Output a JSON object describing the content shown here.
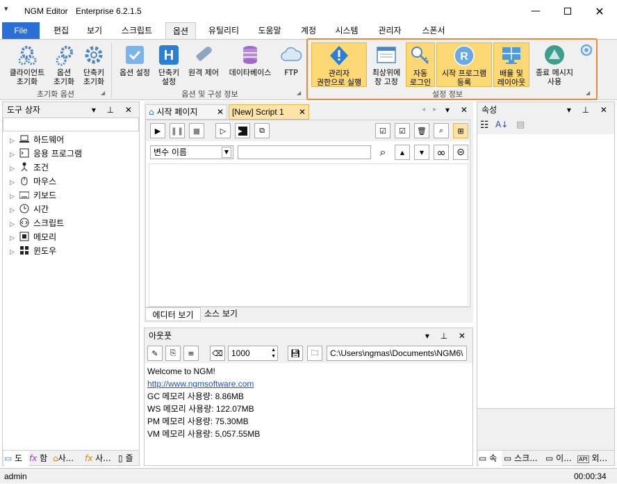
{
  "app": {
    "title": "NGM Editor",
    "edition": "Enterprise 6.2.1.5",
    "qat_icon": "dropdown-icon"
  },
  "window_controls": [
    "minimize-icon",
    "maximize-icon",
    "close-icon"
  ],
  "tabs": [
    {
      "label": "File"
    },
    {
      "label": "편집"
    },
    {
      "label": "보기"
    },
    {
      "label": "스크립트"
    },
    {
      "label": "옵션"
    },
    {
      "label": "유틸리티"
    },
    {
      "label": "도움말"
    },
    {
      "label": "계정"
    },
    {
      "label": "시스템"
    },
    {
      "label": "관리자"
    },
    {
      "label": "스폰서"
    }
  ],
  "ribbon": {
    "reset_group": {
      "name": "초기화 옵션",
      "buttons": [
        {
          "line1": "클라이언트",
          "line2": "초기화",
          "icon": "gear-cluster-icon"
        },
        {
          "line1": "옵션",
          "line2": "초기화",
          "icon": "gear-cluster-icon"
        },
        {
          "line1": "단축키",
          "line2": "초기화",
          "icon": "gear-icon"
        }
      ]
    },
    "options_group": {
      "name": "옵션 및 구성 정보",
      "buttons": [
        {
          "line1": "옵션 설정",
          "line2": "",
          "icon": "checkbox-icon"
        },
        {
          "line1": "단축키",
          "line2": "설정",
          "icon": "hotkey-h-icon"
        },
        {
          "line1": "원격 제어",
          "line2": "",
          "icon": "remote-control-icon"
        },
        {
          "line1": "데이타베이스",
          "line2": "",
          "icon": "database-icon"
        },
        {
          "line1": "FTP",
          "line2": "",
          "icon": "cloud-icon"
        }
      ]
    },
    "settings_group": {
      "name": "설정 정보",
      "buttons": [
        {
          "line1": "관리자",
          "line2": "권한으로 실행",
          "icon": "admin-shield-icon",
          "active": true
        },
        {
          "line1": "최상위에",
          "line2": "창 고정",
          "icon": "window-icon",
          "active": false
        },
        {
          "line1": "자동",
          "line2": "로그인",
          "icon": "key-icon",
          "active": true
        },
        {
          "line1": "시작 프로그램",
          "line2": "등록",
          "icon": "registry-r-icon",
          "active": true
        },
        {
          "line1": "배율 및",
          "line2": "레이아웃",
          "icon": "monitor-icon",
          "active": true
        },
        {
          "line1": "종료 메시지",
          "line2": "사용",
          "icon": "warning-message-icon",
          "active": false
        }
      ]
    }
  },
  "toolbox": {
    "title": "도구 상자",
    "items": [
      {
        "label": "하드웨어",
        "icon": "laptop-icon"
      },
      {
        "label": "응용 프로그램",
        "icon": "terminal-icon"
      },
      {
        "label": "조건",
        "icon": "condition-icon"
      },
      {
        "label": "마우스",
        "icon": "mouse-icon"
      },
      {
        "label": "키보드",
        "icon": "keyboard-icon"
      },
      {
        "label": "시간",
        "icon": "clock-icon"
      },
      {
        "label": "스크립트",
        "icon": "script-icon"
      },
      {
        "label": "메모리",
        "icon": "memory-icon"
      },
      {
        "label": "윈도우",
        "icon": "windows-icon"
      }
    ],
    "bottom_tabs": [
      "도",
      "함",
      "사...",
      "사...",
      "즐"
    ]
  },
  "editor": {
    "tabs": [
      {
        "label": "시작 페이지",
        "active": false
      },
      {
        "label": "[New] Script 1",
        "active": true
      }
    ],
    "variable_select": "변수 이름",
    "bottom_tabs": [
      "에디터 보기",
      "소스 보기"
    ]
  },
  "output": {
    "title": "아웃풋",
    "font_size": "1000",
    "path": "C:\\Users\\ngmas\\Documents\\NGM6\\",
    "lines": [
      "Welcome to NGM!",
      "http://www.ngmsoftware.com",
      "GC 메모리 사용량: 8.86MB",
      "WS 메모리 사용량: 122.07MB",
      "PM 메모리 사용량: 75.30MB",
      "VM 메모리 사용량: 5,057.55MB"
    ]
  },
  "properties": {
    "title": "속성",
    "bottom_tabs": [
      "속",
      "스크...",
      "이...",
      "외..."
    ]
  },
  "status": {
    "user": "admin",
    "time": "00:00:34"
  }
}
